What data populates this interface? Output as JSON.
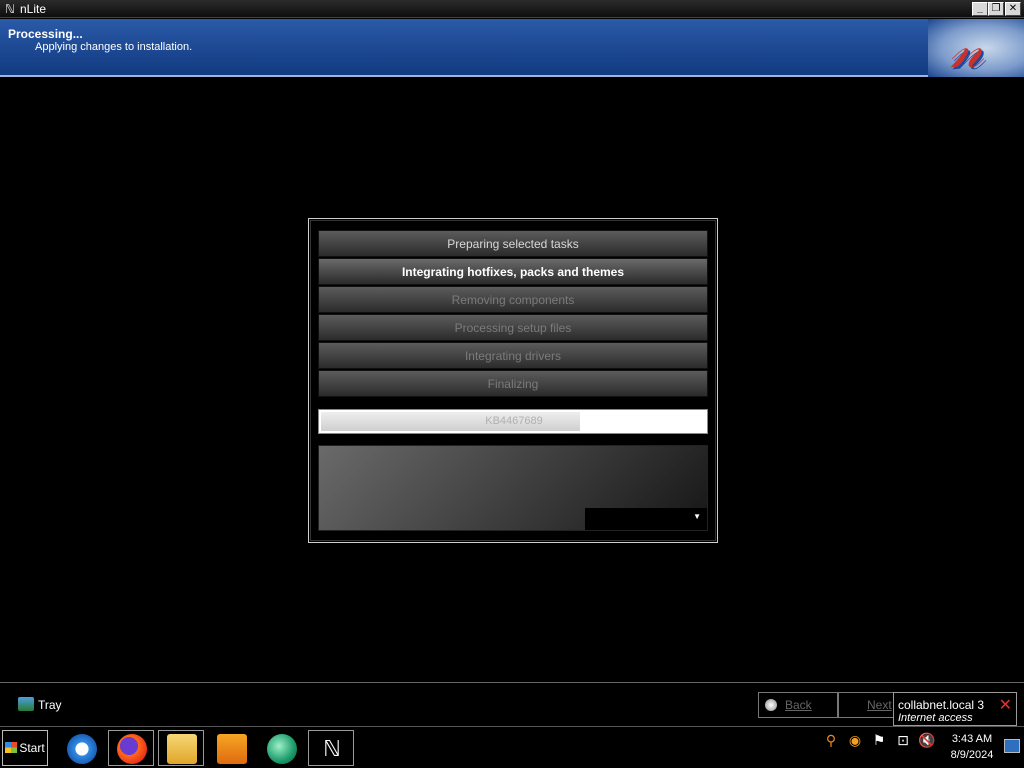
{
  "window": {
    "title": "nLite"
  },
  "header": {
    "title": "Processing...",
    "subtitle": "Applying changes to installation."
  },
  "tasks": [
    {
      "label": "Preparing selected tasks",
      "state": "done"
    },
    {
      "label": "Integrating hotfixes, packs and themes",
      "state": "active"
    },
    {
      "label": "Removing components",
      "state": "pending"
    },
    {
      "label": "Processing setup files",
      "state": "pending"
    },
    {
      "label": "Integrating drivers",
      "state": "pending"
    },
    {
      "label": "Finalizing",
      "state": "pending"
    }
  ],
  "progress": {
    "label": "KB4467689",
    "percent": 67
  },
  "bottombar": {
    "tray_label": "Tray",
    "back_label": "Back",
    "next_label": "Next"
  },
  "network_tooltip": {
    "name": "collabnet.local",
    "count": "3",
    "status": "Internet access"
  },
  "taskbar": {
    "start_label": "Start",
    "apps": [
      "internet-explorer",
      "firefox",
      "file-explorer",
      "media-player",
      "browser",
      "nlite"
    ]
  },
  "clock": {
    "time": "3:43 AM",
    "date": "8/9/2024"
  },
  "colors": {
    "header_blue": "#1e4b96",
    "logo_red": "#c7322a"
  }
}
